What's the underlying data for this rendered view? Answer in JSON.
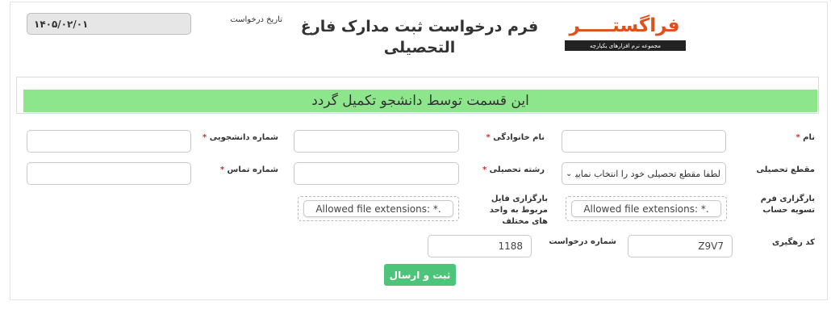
{
  "header": {
    "date_label": "تاریخ درخواست",
    "date_value": "۱۴۰۵/۰۲/۰۱",
    "title_line1": "فرم درخواست ثبت مدارک فارغ",
    "title_line2": "التحصیلی",
    "logo_text": "فراگستـــــر",
    "logo_tagline": "مجموعه نرم افزارهای یکپارچه"
  },
  "notice": "این قسمت توسط دانشجو تکمیل گردد",
  "fields": {
    "name_label": "نام",
    "family_label": "نام خانوادگی",
    "student_no_label": "شماره دانشجویی",
    "degree_label": "مقطع تحصیلی",
    "degree_value": "لطفا مقطع تحصیلی خود را انتخاب نمایید",
    "major_label": "رشته تحصیلی",
    "phone_label": "شماره تماس",
    "settlement_upload_label": "بارگزاری فرم تسویه حساب",
    "settlement_upload_text": "Allowed file extensions: *.",
    "units_upload_label": "بارگزاری فایل مربوط به واحد های مختلف",
    "units_upload_text": "Allowed file extensions: *.",
    "tracking_label": "کد رهگیری",
    "tracking_value": "Z9V7",
    "request_no_label": "شماره درخواست",
    "request_no_value": "1188",
    "required_mark": "*"
  },
  "submit_label": "ثبت و ارسال",
  "colors": {
    "notice_bg": "#8ee68c",
    "submit_bg": "#4cc479",
    "logo_accent": "#e0501b",
    "required": "#d0312d"
  }
}
